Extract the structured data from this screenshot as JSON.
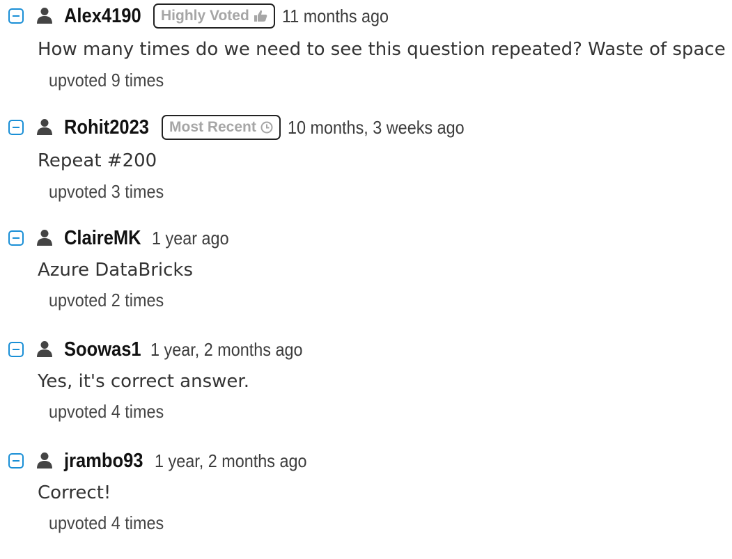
{
  "comments": [
    {
      "user": "Alex4190",
      "badge": "Highly Voted",
      "badge_icon": "thumbs-up-icon",
      "time": "11 months ago",
      "text": "How many times do we need to see this question repeated? Waste of space",
      "votes": "upvoted 9 times"
    },
    {
      "user": "Rohit2023",
      "badge": "Most Recent",
      "badge_icon": "clock-icon",
      "time": "10 months, 3 weeks ago",
      "text": "Repeat #200",
      "votes": "upvoted 3 times"
    },
    {
      "user": "ClaireMK",
      "time": "1 year ago",
      "text": "Azure DataBricks",
      "votes": "upvoted 2 times"
    },
    {
      "user": "Soowas1",
      "time": "1 year, 2 months ago",
      "text": "Yes, it's correct answer.",
      "votes": "upvoted 4 times"
    },
    {
      "user": "jrambo93",
      "time": "1 year, 2 months ago",
      "text": "Correct!",
      "votes": "upvoted 4 times"
    }
  ],
  "colors": {
    "collapse": "#1a8fd6",
    "username": "#111111",
    "badge_text": "#a6a6a6"
  }
}
